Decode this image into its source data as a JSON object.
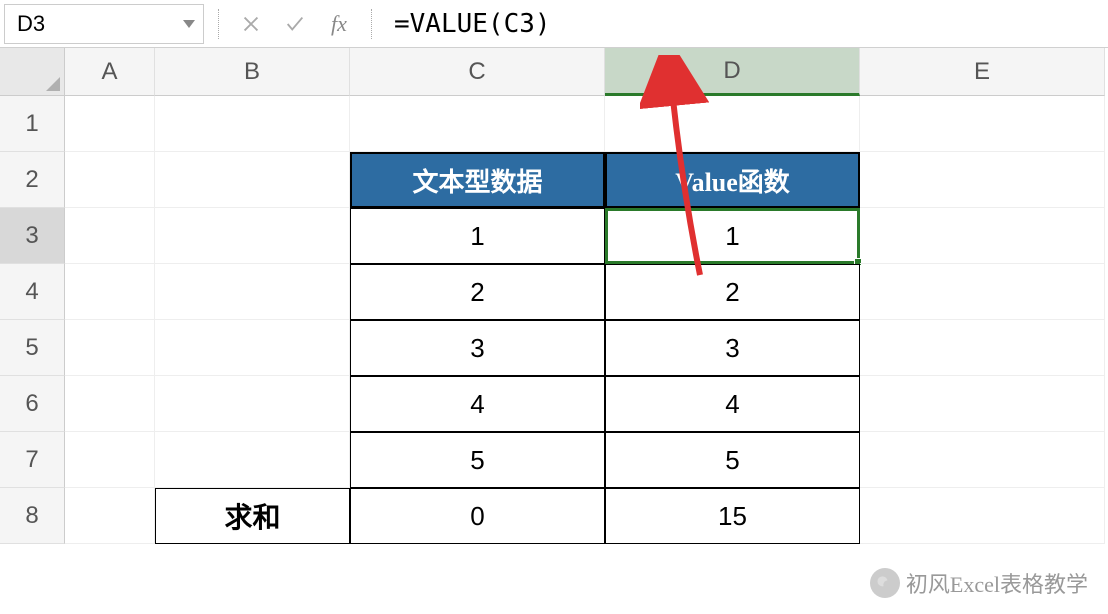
{
  "name_box": "D3",
  "formula": "=VALUE(C3)",
  "columns": [
    "A",
    "B",
    "C",
    "D",
    "E"
  ],
  "rows": [
    "1",
    "2",
    "3",
    "4",
    "5",
    "6",
    "7",
    "8"
  ],
  "active_row": "3",
  "active_col": "D",
  "table": {
    "header_c": "文本型数据",
    "header_d": "Value函数",
    "sum_label": "求和",
    "rows": [
      {
        "c": "1",
        "d": "1"
      },
      {
        "c": "2",
        "d": "2"
      },
      {
        "c": "3",
        "d": "3"
      },
      {
        "c": "4",
        "d": "4"
      },
      {
        "c": "5",
        "d": "5"
      }
    ],
    "sum_c": "0",
    "sum_d": "15"
  },
  "watermark": "初风Excel表格教学",
  "icons": {
    "cancel": "×",
    "confirm": "✓",
    "fx": "fx"
  }
}
